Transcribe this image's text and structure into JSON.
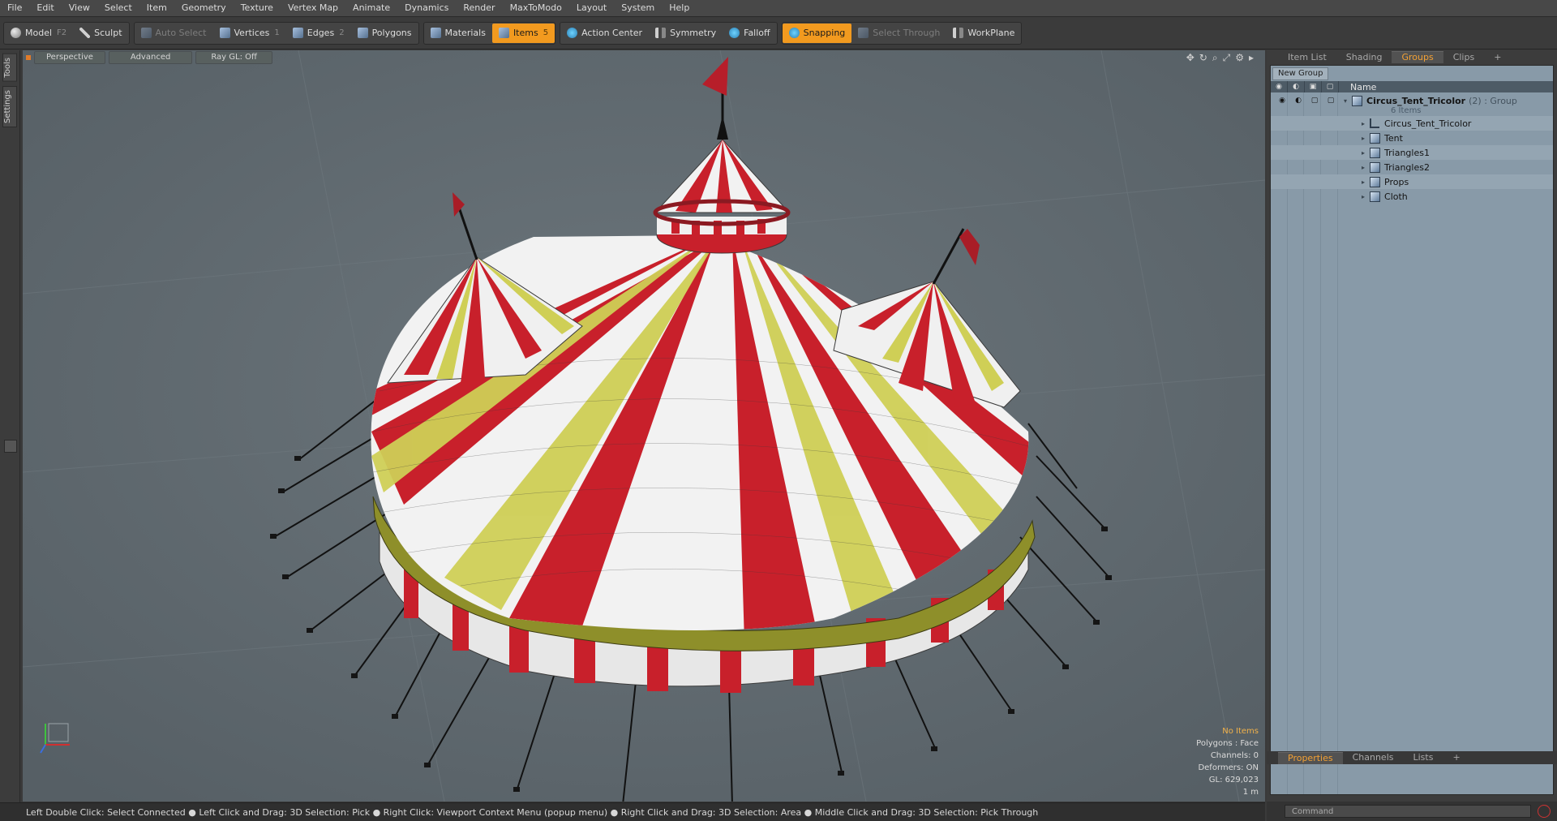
{
  "menu": [
    "File",
    "Edit",
    "View",
    "Select",
    "Item",
    "Geometry",
    "Texture",
    "Vertex Map",
    "Animate",
    "Dynamics",
    "Render",
    "MaxToModo",
    "Layout",
    "System",
    "Help"
  ],
  "toolbar": {
    "model": "Model",
    "model_key": "F2",
    "sculpt": "Sculpt",
    "auto_select": "Auto Select",
    "vertices": "Vertices",
    "vertices_key": "1",
    "edges": "Edges",
    "edges_key": "2",
    "polygons": "Polygons",
    "materials": "Materials",
    "items": "Items",
    "items_key": "5",
    "action_center": "Action Center",
    "symmetry": "Symmetry",
    "falloff": "Falloff",
    "snapping": "Snapping",
    "select_through": "Select Through",
    "workplane": "WorkPlane",
    "accent": "#f29a1f"
  },
  "left_tabs": [
    "Tools",
    "Settings"
  ],
  "viewport": {
    "view_mode": "Perspective",
    "shading": "Advanced",
    "raygl": "Ray GL: Off",
    "info": {
      "no_items": "No Items",
      "polygons": "Polygons : Face",
      "channels": "Channels: 0",
      "deformers": "Deformers: ON",
      "gl": "GL: 629,023",
      "scale": "1 m"
    }
  },
  "status": "Left Double Click: Select Connected ● Left Click and Drag: 3D Selection: Pick ● Right Click: Viewport Context Menu (popup menu) ● Right Click and Drag: 3D Selection: Area ● Middle Click and Drag: 3D Selection: Pick Through",
  "right_panel": {
    "tabs": [
      "Item List",
      "Shading",
      "Groups",
      "Clips"
    ],
    "active_tab": "Groups",
    "new_group": "New Group",
    "name_header": "Name",
    "group": {
      "name": "Circus_Tent_Tricolor",
      "meta": "(2) : Group",
      "count": "6 Items"
    },
    "children": [
      "Circus_Tent_Tricolor",
      "Tent",
      "Triangles1",
      "Triangles2",
      "Props",
      "Cloth"
    ]
  },
  "bottom_tabs": [
    "Properties",
    "Channels",
    "Lists"
  ],
  "command_placeholder": "Command"
}
